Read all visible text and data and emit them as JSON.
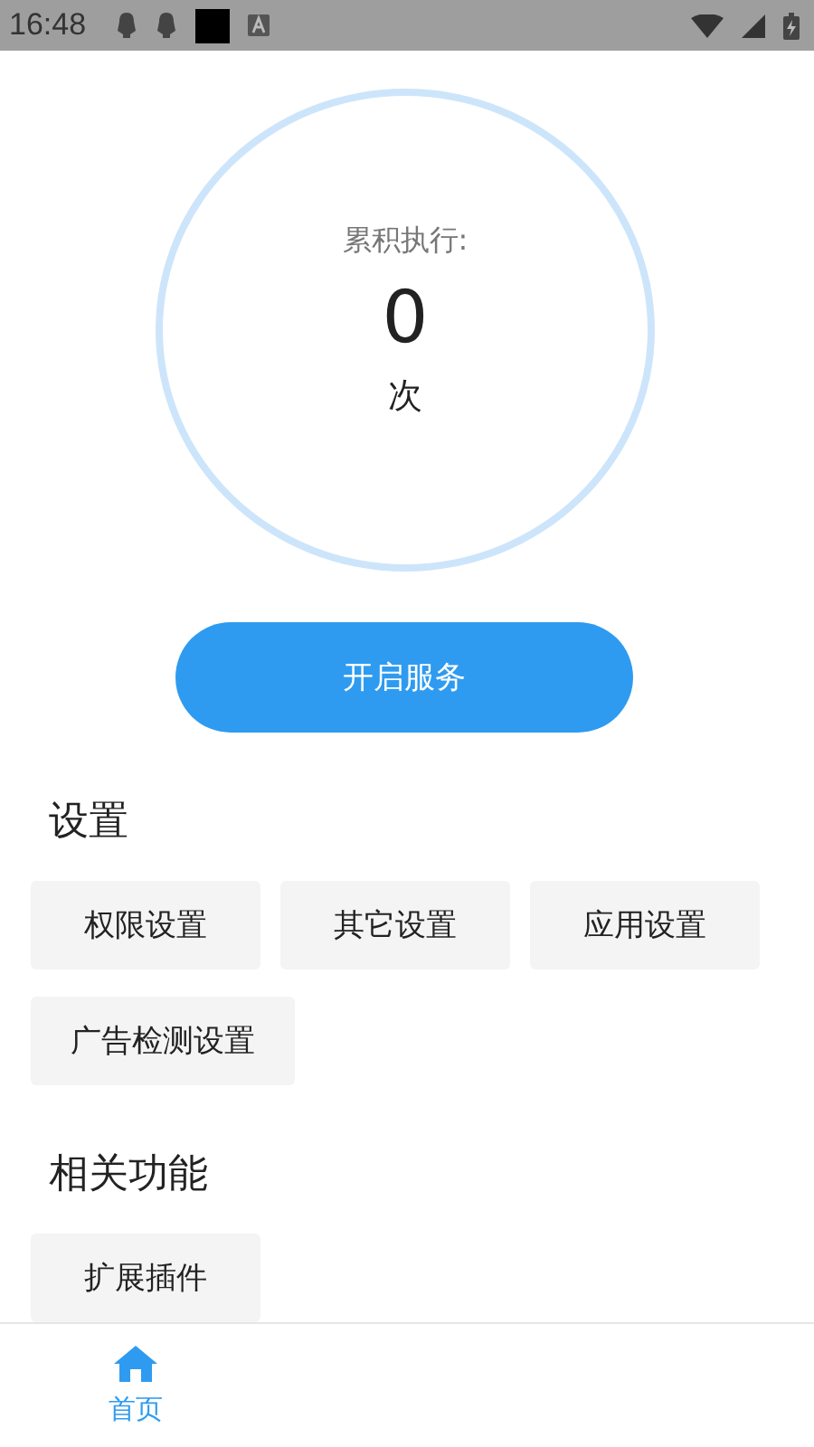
{
  "status_bar": {
    "time": "16:48"
  },
  "counter": {
    "label": "累积执行:",
    "value": "0",
    "unit": "次"
  },
  "start_button": "开启服务",
  "sections": [
    {
      "title": "设置",
      "buttons": [
        "权限设置",
        "其它设置",
        "应用设置",
        "广告检测设置"
      ]
    },
    {
      "title": "相关功能",
      "buttons": [
        "扩展插件"
      ]
    }
  ],
  "nav": [
    {
      "label": "首页",
      "selected": true
    }
  ]
}
